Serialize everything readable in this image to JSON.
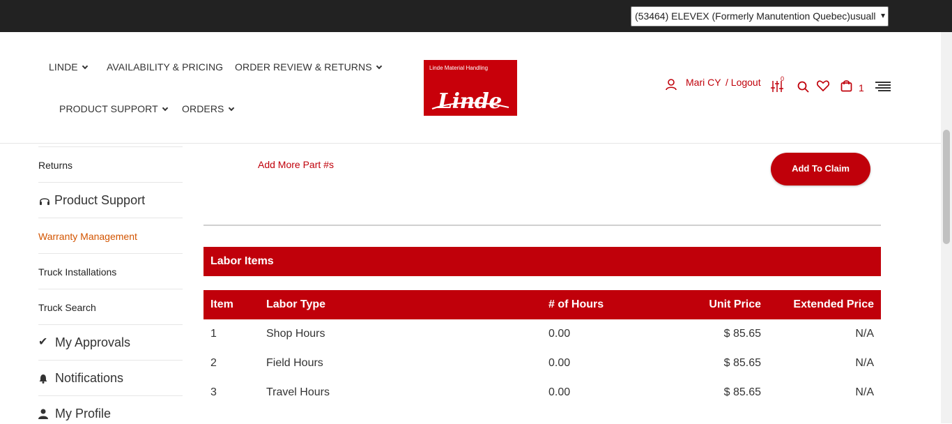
{
  "account_selector": {
    "value": "(53464) ELEVEX (Formerly Manutention Quebec)usuall"
  },
  "nav": {
    "linde": "LINDE",
    "availability": "AVAILABILITY & PRICING",
    "order_review": "ORDER REVIEW & RETURNS",
    "product_support": "PRODUCT SUPPORT",
    "orders": "ORDERS"
  },
  "logo": {
    "tagline": "Linde Material Handling",
    "brand": "Linde"
  },
  "user": {
    "name": "Mari CY",
    "logout": "/ Logout",
    "compare_count": "0",
    "cart_count": "1"
  },
  "sidebar": {
    "returns": "Returns",
    "product_support": "Product Support",
    "warranty": "Warranty Management",
    "truck_installations": "Truck Installations",
    "truck_search": "Truck Search",
    "my_approvals": "My Approvals",
    "notifications": "Notifications",
    "my_profile": "My Profile"
  },
  "actions": {
    "add_more": "Add More Part #s",
    "add_to_claim": "Add To Claim"
  },
  "labor": {
    "title": "Labor Items",
    "headers": {
      "item": "Item",
      "type": "Labor Type",
      "hours": "# of Hours",
      "unit": "Unit Price",
      "extended": "Extended Price"
    },
    "rows": [
      {
        "item": "1",
        "type": "Shop Hours",
        "hours": "0.00",
        "unit": "$  85.65",
        "extended": "N/A"
      },
      {
        "item": "2",
        "type": "Field Hours",
        "hours": "0.00",
        "unit": "$  85.65",
        "extended": "N/A"
      },
      {
        "item": "3",
        "type": "Travel Hours",
        "hours": "0.00",
        "unit": "$  85.65",
        "extended": "N/A"
      }
    ]
  },
  "colors": {
    "brand_red": "#c0000a",
    "top_bar": "#222222",
    "active_link": "#d35400"
  }
}
